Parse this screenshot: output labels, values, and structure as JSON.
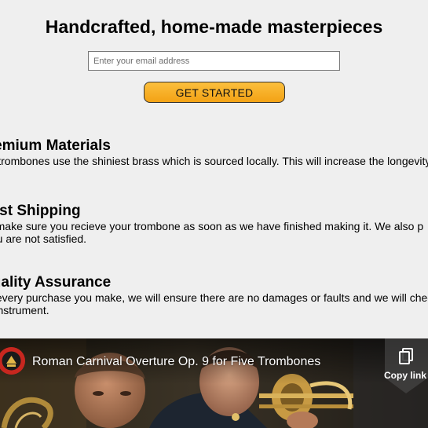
{
  "hero": {
    "title": "Handcrafted, home-made masterpieces",
    "email_placeholder": "Enter your email address",
    "cta_label": "GET STARTED"
  },
  "features": [
    {
      "title": "Premium Materials",
      "text": "Our trombones use the shiniest brass which is sourced locally. This will increase the longevity of your purchase."
    },
    {
      "title": "Fast Shipping",
      "text_lines": [
        "We make sure you recieve your trombone as soon as we have finished making it. We also p",
        "if you are not satisfied."
      ]
    },
    {
      "title": "Quality Assurance",
      "text_lines": [
        "For every purchase you make, we will ensure there are no damages or faults and we will chec",
        "the instrument."
      ]
    }
  ],
  "video": {
    "title": "Roman Carnival Overture Op. 9 for Five Trombones",
    "copy_link_label": "Copy link"
  },
  "colors": {
    "page_background": "#efefef",
    "cta_gradient_top": "#fbbf3d",
    "cta_gradient_bottom": "#f3a215",
    "avatar_red": "#c7271f"
  }
}
